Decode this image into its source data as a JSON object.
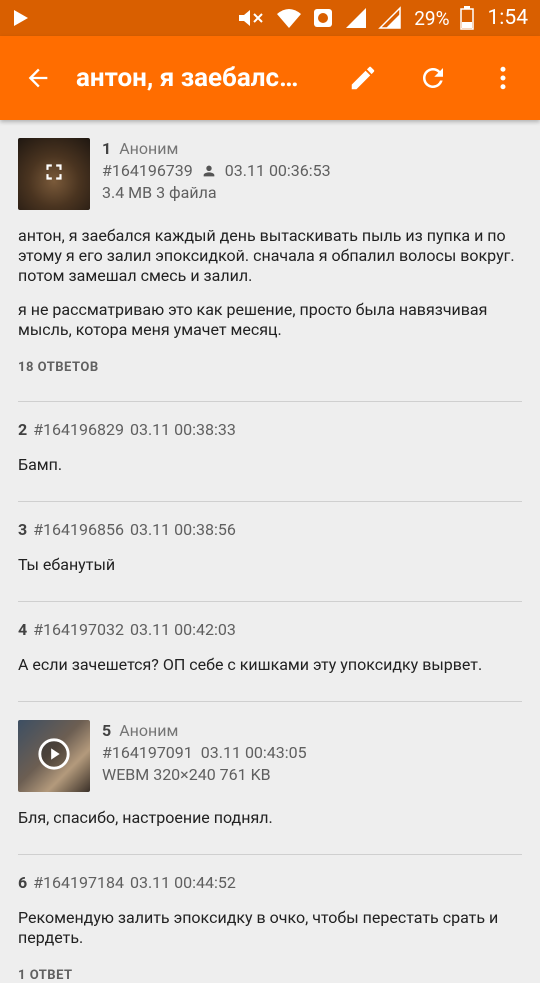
{
  "status_bar": {
    "battery_pct": "29%",
    "time": "1:54",
    "icons": [
      "play-icon",
      "mute-icon",
      "wifi-icon",
      "data-saver-icon",
      "signal-icon",
      "signal-icon-2",
      "battery-icon"
    ]
  },
  "toolbar": {
    "title": "антон, я заебалс…",
    "back_icon": "arrow-back-icon",
    "actions": [
      "edit-icon",
      "refresh-icon",
      "more-vertical-icon"
    ]
  },
  "posts": [
    {
      "num": "1",
      "name": "Аноним",
      "id": "#164196739",
      "date": "03.11 00:36:53",
      "files": "3.4 MB 3 файла",
      "body": [
        "антон, я заебался каждый день вытаскивать пыль из пупка и по этому я его залил эпоксидкой. сначала я обпалил волосы вокруг. потом замешал смесь и залил.",
        "я не рассматриваю это как решение, просто была навязчивая мысль, котора меня умачет месяц."
      ],
      "replies": "18 ОТВЕТОВ"
    },
    {
      "num": "2",
      "id": "#164196829",
      "date": "03.11 00:38:33",
      "body": [
        "Бамп."
      ]
    },
    {
      "num": "3",
      "id": "#164196856",
      "date": "03.11 00:38:56",
      "body": [
        "Ты ебанутый"
      ]
    },
    {
      "num": "4",
      "id": "#164197032",
      "date": "03.11 00:42:03",
      "body": [
        "А если зачешется? ОП себе с кишками эту упоксидку вырвет."
      ]
    },
    {
      "num": "5",
      "name": "Аноним",
      "id": "#164197091",
      "date": "03.11 00:43:05",
      "files": "WEBM 320×240 761 KB",
      "body": [
        "Бля, спасибо, настроение поднял."
      ]
    },
    {
      "num": "6",
      "id": "#164197184",
      "date": "03.11 00:44:52",
      "body": [
        "Рекомендую залить эпоксидку в очко, чтобы перестать срать и пердеть."
      ],
      "replies": "1 ОТВЕТ"
    }
  ]
}
